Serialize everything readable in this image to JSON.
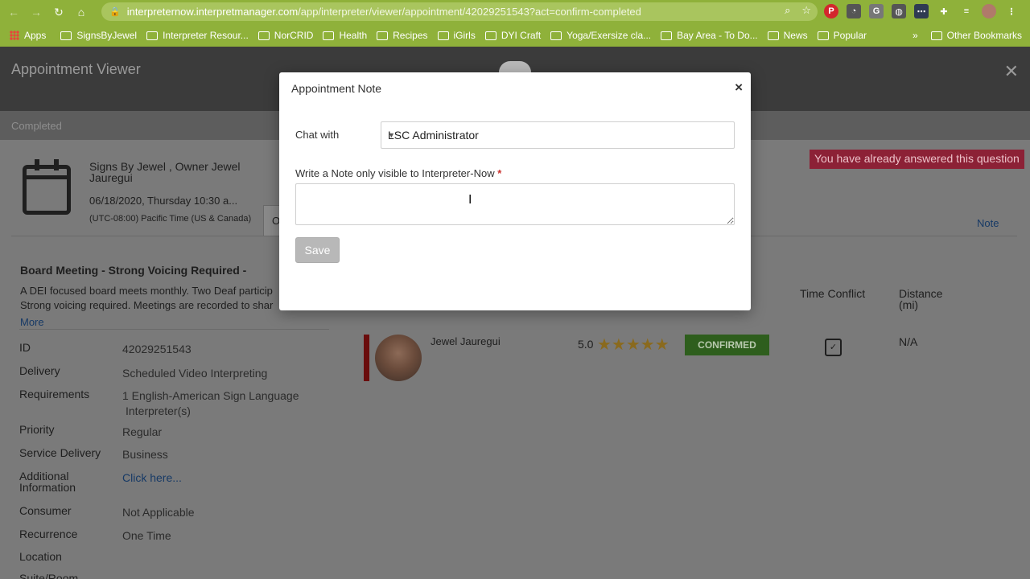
{
  "browser": {
    "url_domain": "interpreternow.interpretmanager.com",
    "url_path": "/app/interpreter/viewer/appointment/42029251543?act=confirm-completed",
    "bookmarks": [
      "Apps",
      "SignsByJewel",
      "Interpreter Resour...",
      "NorCRID",
      "Health",
      "Recipes",
      "iGirls",
      "DYI Craft",
      "Yoga/Exersize cla...",
      "Bay Area - To Do...",
      "News",
      "Popular"
    ],
    "bookmarks_more": "»",
    "other_bookmarks": "Other Bookmarks"
  },
  "app": {
    "title": "Appointment Viewer",
    "status": "Completed",
    "customer_line1": "Signs By Jewel , Owner Jewel",
    "customer_line2": "Jauregui",
    "datetime": "06/18/2020, Thursday 10:30 a...",
    "timezone": "(UTC-08:00) Pacific Time (US & Canada)",
    "tab_stub": "O",
    "already_answered": "You have already answered this question",
    "note_link": "Note",
    "meeting_title": "Board Meeting - Strong Voicing Required -",
    "description_line1": "A DEI focused board meets monthly. Two Deaf particip",
    "description_line2": "Strong voicing required. Meetings are recorded to shar",
    "more_link": "More",
    "details": [
      {
        "label": "ID",
        "value": "42029251543"
      },
      {
        "label": "Delivery",
        "value": "Scheduled Video Interpreting"
      },
      {
        "label": "Requirements",
        "value": "1  English-American Sign Language",
        "value2": "Interpreter(s)"
      },
      {
        "label": "Priority",
        "value": "Regular"
      },
      {
        "label": "Service Delivery",
        "value": "Business"
      },
      {
        "label": "Additional",
        "label2": "Information",
        "value": "Click here..."
      },
      {
        "label": "Consumer",
        "value": "Not Applicable"
      },
      {
        "label": "Recurrence",
        "value": "One Time"
      },
      {
        "label": "Location",
        "value": ""
      },
      {
        "label": "Suite/Room",
        "value": ""
      }
    ],
    "columns": {
      "time_conflict": "Time Conflict",
      "distance": "Distance",
      "distance_unit": "(mi)"
    },
    "interpreter": {
      "name": "Jewel Jauregui",
      "rating": "5.0",
      "stars": "★★★★★",
      "status": "CONFIRMED",
      "distance": "N/A"
    }
  },
  "modal": {
    "title": "Appointment Note",
    "close": "×",
    "chat_label": "Chat with",
    "chat_value": "LSC Administrator",
    "note_label": "Write a Note only visible to Interpreter-Now",
    "required_mark": "*",
    "save_label": "Save"
  }
}
